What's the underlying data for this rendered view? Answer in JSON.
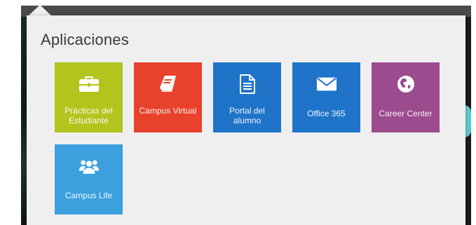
{
  "panel": {
    "title": "Aplicaciones"
  },
  "tiles": [
    {
      "label": "Prácticas del Estudiante",
      "icon": "briefcase-icon",
      "color": "#b3c41d"
    },
    {
      "label": "Campus Virtual",
      "icon": "book-icon",
      "color": "#e8412c"
    },
    {
      "label": "Portal del alumno",
      "icon": "document-icon",
      "color": "#1f74c9"
    },
    {
      "label": "Office 365",
      "icon": "envelope-icon",
      "color": "#1f74c9"
    },
    {
      "label": "Career Center",
      "icon": "globe-icon",
      "color": "#9b4b8e"
    },
    {
      "label": "Campus Life",
      "icon": "users-icon",
      "color": "#3ca0df"
    }
  ]
}
